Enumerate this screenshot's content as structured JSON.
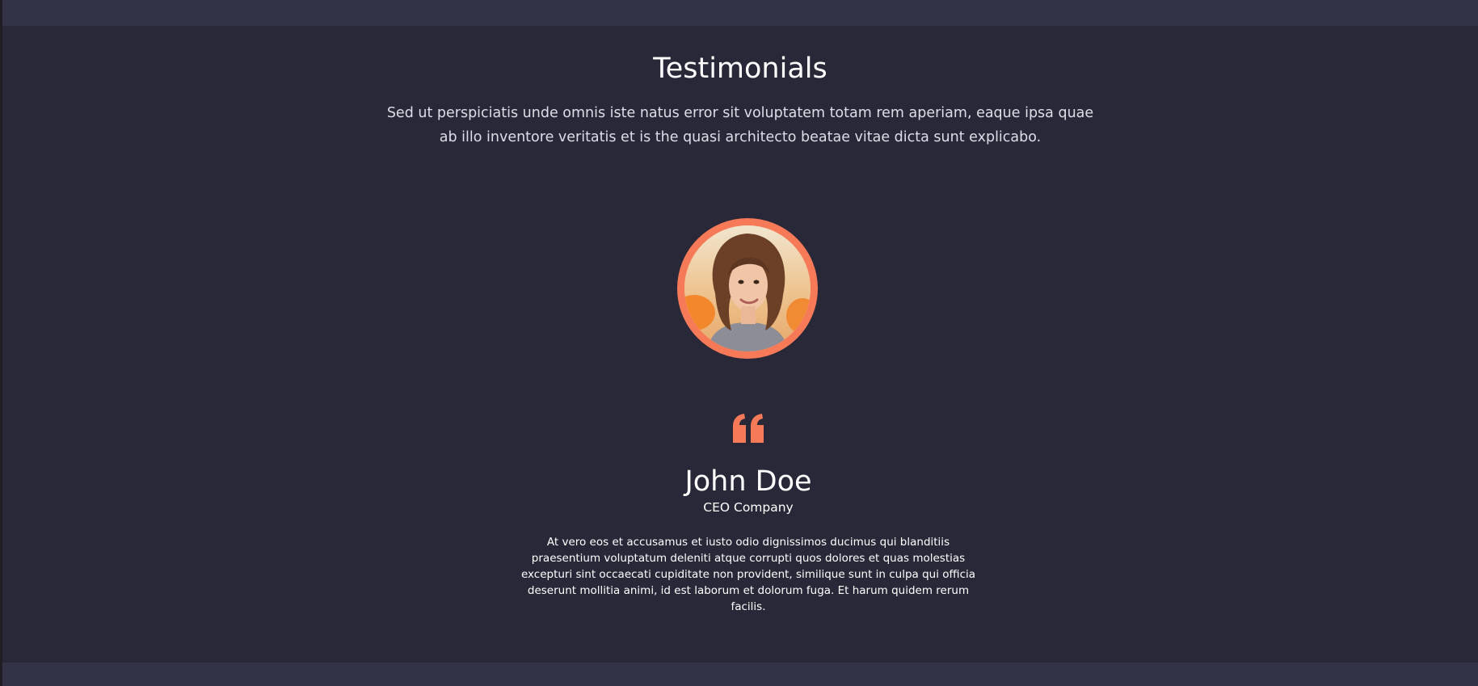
{
  "testimonials": {
    "title": "Testimonials",
    "intro": "Sed ut perspiciatis unde omnis iste natus error sit voluptatem totam rem aperiam, eaque ipsa quae ab illo inventore veritatis et is the quasi architecto beatae vitae dicta sunt explicabo.",
    "accent_color": "#f77a58",
    "background_color": "#282838",
    "strip_color": "#323346",
    "item": {
      "avatar_icon": "person-photo",
      "quote_icon": "quote-left-icon",
      "name": "John Doe",
      "role": "CEO Company",
      "text": "At vero eos et accusamus et iusto odio dignissimos ducimus qui blanditiis praesentium voluptatum deleniti atque corrupti quos dolores et quas molestias excepturi sint occaecati cupiditate non provident, similique sunt in culpa qui officia deserunt mollitia animi, id est laborum et dolorum fuga. Et harum quidem rerum facilis."
    }
  }
}
